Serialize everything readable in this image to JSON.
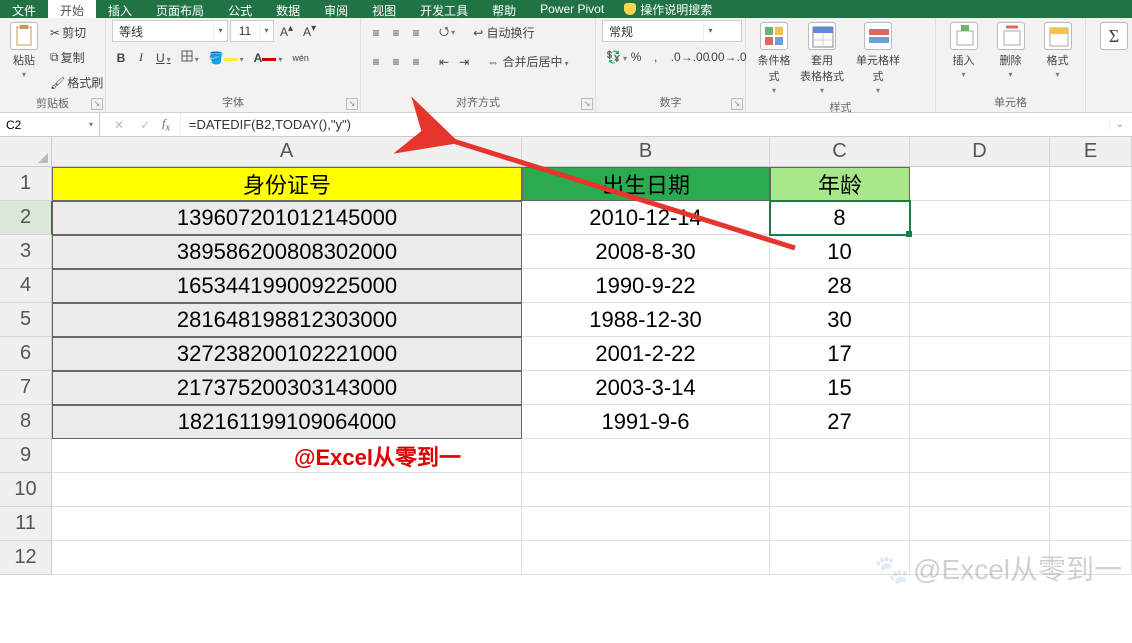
{
  "tabs": {
    "file": "文件",
    "home": "开始",
    "insert": "插入",
    "layout": "页面布局",
    "formulas": "公式",
    "data": "数据",
    "review": "审阅",
    "view": "视图",
    "developer": "开发工具",
    "help": "帮助",
    "powerpivot": "Power Pivot",
    "tellme": "操作说明搜索"
  },
  "clipboard": {
    "paste": "粘贴",
    "cut": "剪切",
    "copy": "复制",
    "format_painter": "格式刷",
    "title": "剪贴板"
  },
  "font": {
    "name": "等线",
    "size": "11",
    "bold": "B",
    "italic": "I",
    "underline": "U",
    "ruby": "wén",
    "title": "字体"
  },
  "align": {
    "wrap": "自动换行",
    "merge": "合并后居中",
    "title": "对齐方式"
  },
  "number": {
    "format": "常规",
    "title": "数字"
  },
  "styles": {
    "cond": "条件格式",
    "table": "套用\n表格格式",
    "cell": "单元格样式",
    "title": "样式"
  },
  "cells": {
    "insert": "插入",
    "delete": "删除",
    "format": "格式",
    "title": "单元格"
  },
  "namebox": "C2",
  "formula": "=DATEDIF(B2,TODAY(),\"y\")",
  "columns": [
    "A",
    "B",
    "C",
    "D",
    "E"
  ],
  "headers": {
    "A": "身份证号",
    "B": "出生日期",
    "C": "年龄"
  },
  "rows": [
    {
      "n": 1
    },
    {
      "n": 2,
      "A": "139607201012145000",
      "B": "2010-12-14",
      "C": "8"
    },
    {
      "n": 3,
      "A": "389586200808302000",
      "B": "2008-8-30",
      "C": "10"
    },
    {
      "n": 4,
      "A": "165344199009225000",
      "B": "1990-9-22",
      "C": "28"
    },
    {
      "n": 5,
      "A": "281648198812303000",
      "B": "1988-12-30",
      "C": "30"
    },
    {
      "n": 6,
      "A": "327238200102221000",
      "B": "2001-2-22",
      "C": "17"
    },
    {
      "n": 7,
      "A": "217375200303143000",
      "B": "2003-3-14",
      "C": "15"
    },
    {
      "n": 8,
      "A": "182161199109064000",
      "B": "1991-9-6",
      "C": "27"
    },
    {
      "n": 9
    },
    {
      "n": 10
    },
    {
      "n": 11
    },
    {
      "n": 12
    }
  ],
  "annotation": "@Excel从零到一",
  "watermark": "@Excel从零到一"
}
